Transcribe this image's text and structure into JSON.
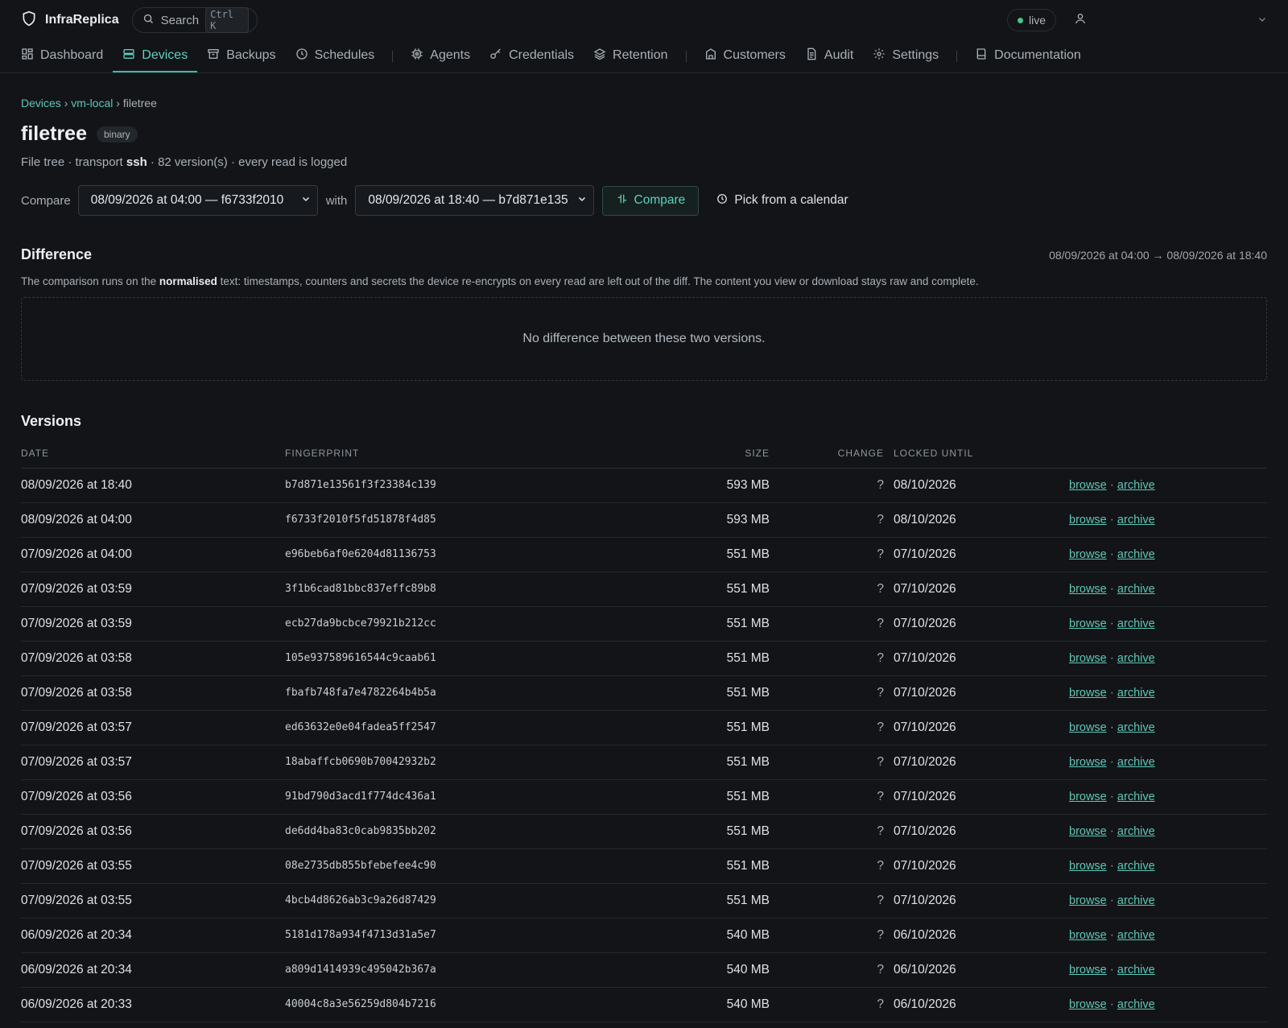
{
  "brand": {
    "name": "InfraReplica"
  },
  "search": {
    "label": "Search",
    "shortcut": "Ctrl K"
  },
  "status": {
    "live_label": "live"
  },
  "nav": [
    {
      "label": "Dashboard",
      "icon": "dashboard-icon",
      "active": false
    },
    {
      "label": "Devices",
      "icon": "devices-icon",
      "active": true
    },
    {
      "label": "Backups",
      "icon": "archive-box-icon",
      "active": false
    },
    {
      "label": "Schedules",
      "icon": "clock-icon",
      "active": false
    },
    {
      "label": "Agents",
      "icon": "chip-icon",
      "active": false
    },
    {
      "label": "Credentials",
      "icon": "key-icon",
      "active": false
    },
    {
      "label": "Retention",
      "icon": "layers-icon",
      "active": false
    },
    {
      "label": "Customers",
      "icon": "building-icon",
      "active": false
    },
    {
      "label": "Audit",
      "icon": "document-icon",
      "active": false
    },
    {
      "label": "Settings",
      "icon": "gear-icon",
      "active": false
    },
    {
      "label": "Documentation",
      "icon": "book-icon",
      "active": false
    }
  ],
  "breadcrumb": {
    "devices": "Devices",
    "device": "vm-local",
    "current": "filetree",
    "sep": "›"
  },
  "page": {
    "title": "filetree",
    "badge": "binary",
    "subtitle_prefix": "File tree · transport ",
    "subtitle_transport": "ssh",
    "subtitle_suffix": " · 82 version(s) · every read is logged"
  },
  "compare": {
    "label": "Compare",
    "from_value": "08/09/2026 at 04:00 — f6733f2010",
    "with_label": "with",
    "to_value": "08/09/2026 at 18:40 — b7d871e135",
    "button_label": "Compare",
    "calendar_label": "Pick from a calendar"
  },
  "difference": {
    "title": "Difference",
    "range": "08/09/2026 at 04:00 → 08/09/2026 at 18:40",
    "note_prefix": "The comparison runs on the ",
    "note_bold": "normalised",
    "note_suffix": " text: timestamps, counters and secrets the device re-encrypts on every read are left out of the diff. The content you view or download stays raw and complete.",
    "empty_message": "No difference between these two versions."
  },
  "versions": {
    "title": "Versions",
    "columns": [
      "DATE",
      "FINGERPRINT",
      "SIZE",
      "CHANGE",
      "LOCKED UNTIL"
    ],
    "browse_label": "browse",
    "archive_label": "archive",
    "rows": [
      {
        "date": "08/09/2026 at 18:40",
        "fingerprint": "b7d871e13561f3f23384c139",
        "size": "593 MB",
        "change": "?",
        "locked": "08/10/2026"
      },
      {
        "date": "08/09/2026 at 04:00",
        "fingerprint": "f6733f2010f5fd51878f4d85",
        "size": "593 MB",
        "change": "?",
        "locked": "08/10/2026"
      },
      {
        "date": "07/09/2026 at 04:00",
        "fingerprint": "e96beb6af0e6204d81136753",
        "size": "551 MB",
        "change": "?",
        "locked": "07/10/2026"
      },
      {
        "date": "07/09/2026 at 03:59",
        "fingerprint": "3f1b6cad81bbc837effc89b8",
        "size": "551 MB",
        "change": "?",
        "locked": "07/10/2026"
      },
      {
        "date": "07/09/2026 at 03:59",
        "fingerprint": "ecb27da9bcbce79921b212cc",
        "size": "551 MB",
        "change": "?",
        "locked": "07/10/2026"
      },
      {
        "date": "07/09/2026 at 03:58",
        "fingerprint": "105e937589616544c9caab61",
        "size": "551 MB",
        "change": "?",
        "locked": "07/10/2026"
      },
      {
        "date": "07/09/2026 at 03:58",
        "fingerprint": "fbafb748fa7e4782264b4b5a",
        "size": "551 MB",
        "change": "?",
        "locked": "07/10/2026"
      },
      {
        "date": "07/09/2026 at 03:57",
        "fingerprint": "ed63632e0e04fadea5ff2547",
        "size": "551 MB",
        "change": "?",
        "locked": "07/10/2026"
      },
      {
        "date": "07/09/2026 at 03:57",
        "fingerprint": "18abaffcb0690b70042932b2",
        "size": "551 MB",
        "change": "?",
        "locked": "07/10/2026"
      },
      {
        "date": "07/09/2026 at 03:56",
        "fingerprint": "91bd790d3acd1f774dc436a1",
        "size": "551 MB",
        "change": "?",
        "locked": "07/10/2026"
      },
      {
        "date": "07/09/2026 at 03:56",
        "fingerprint": "de6dd4ba83c0cab9835bb202",
        "size": "551 MB",
        "change": "?",
        "locked": "07/10/2026"
      },
      {
        "date": "07/09/2026 at 03:55",
        "fingerprint": "08e2735db855bfebefee4c90",
        "size": "551 MB",
        "change": "?",
        "locked": "07/10/2026"
      },
      {
        "date": "07/09/2026 at 03:55",
        "fingerprint": "4bcb4d8626ab3c9a26d87429",
        "size": "551 MB",
        "change": "?",
        "locked": "07/10/2026"
      },
      {
        "date": "06/09/2026 at 20:34",
        "fingerprint": "5181d178a934f4713d31a5e7",
        "size": "540 MB",
        "change": "?",
        "locked": "06/10/2026"
      },
      {
        "date": "06/09/2026 at 20:34",
        "fingerprint": "a809d1414939c495042b367a",
        "size": "540 MB",
        "change": "?",
        "locked": "06/10/2026"
      },
      {
        "date": "06/09/2026 at 20:33",
        "fingerprint": "40004c8a3e56259d804b7216",
        "size": "540 MB",
        "change": "?",
        "locked": "06/10/2026"
      }
    ]
  }
}
